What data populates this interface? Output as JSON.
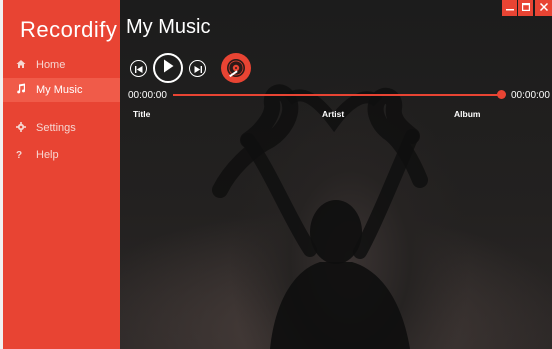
{
  "app": {
    "title": "Recordify"
  },
  "sidebar": {
    "items": [
      {
        "label": "Home",
        "icon": "home-icon",
        "active": false
      },
      {
        "label": "My Music",
        "icon": "music-note-icon",
        "active": true
      },
      {
        "label": "Settings",
        "icon": "gear-icon",
        "active": false
      },
      {
        "label": "Help",
        "icon": "question-icon",
        "active": false
      }
    ]
  },
  "main": {
    "title": "My Music",
    "player": {
      "elapsed": "00:00:00",
      "total": "00:00:00",
      "progress": 1.0
    },
    "columns": [
      "Title",
      "Artist",
      "Album"
    ]
  },
  "window": {
    "minimize": "_",
    "maximize": "□",
    "close": "✕"
  },
  "colors": {
    "accent": "#e84433",
    "accent_active": "#f05b49",
    "background": "#1e1c1c"
  }
}
